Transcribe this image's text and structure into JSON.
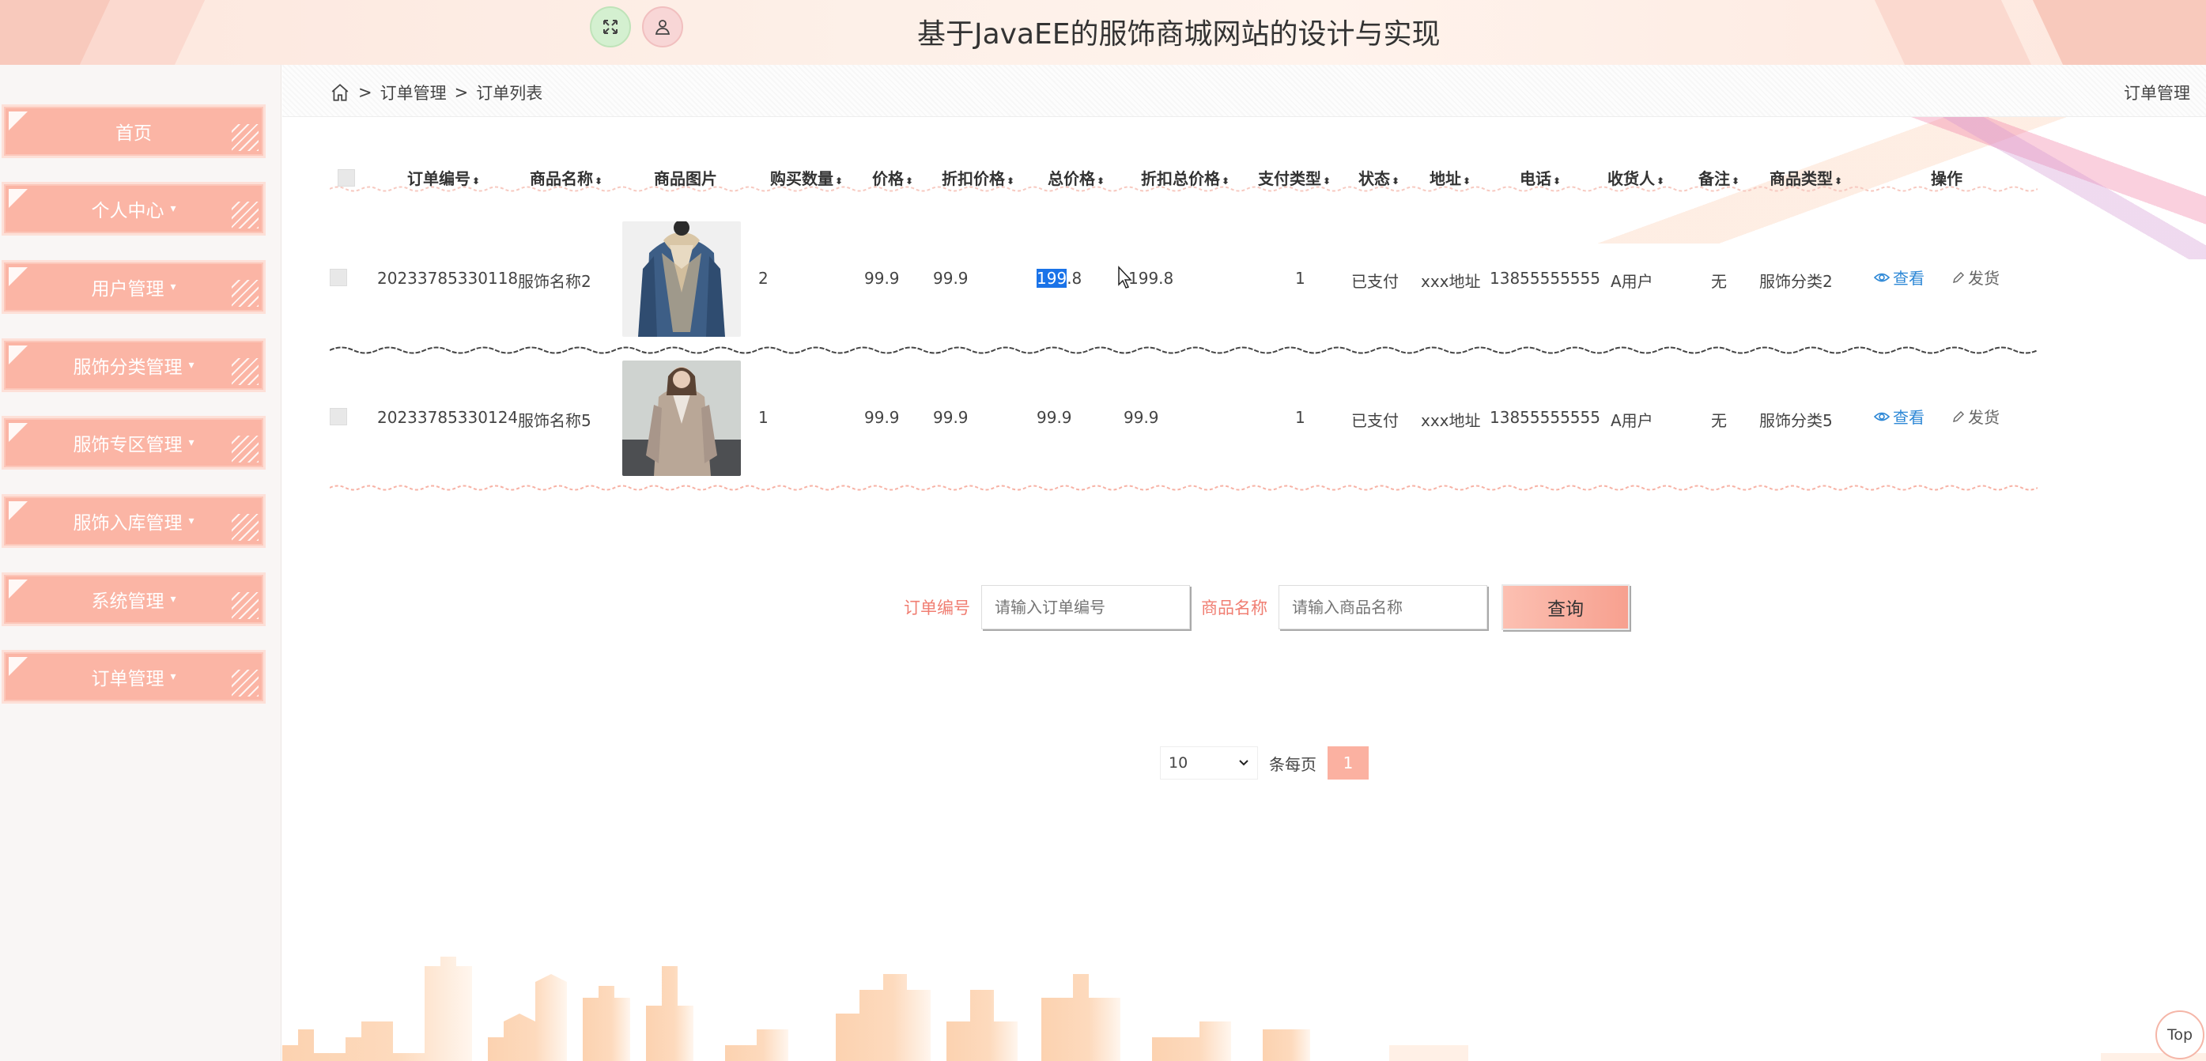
{
  "header": {
    "title": "基于JavaEE的服饰商城网站的设计与实现"
  },
  "sidebar": {
    "items": [
      {
        "label": "首页",
        "caret": ""
      },
      {
        "label": "个人中心",
        "caret": "▾"
      },
      {
        "label": "用户管理",
        "caret": "▾"
      },
      {
        "label": "服饰分类管理",
        "caret": "▾"
      },
      {
        "label": "服饰专区管理",
        "caret": "▾"
      },
      {
        "label": "服饰入库管理",
        "caret": "▾"
      },
      {
        "label": "系统管理",
        "caret": "▾"
      },
      {
        "label": "订单管理",
        "caret": "▾"
      }
    ]
  },
  "breadcrumb": {
    "sep1": ">",
    "level1": "订单管理",
    "sep2": ">",
    "level2": "订单列表",
    "right": "订单管理"
  },
  "table": {
    "columns": [
      "订单编号",
      "商品名称",
      "商品图片",
      "购买数量",
      "价格",
      "折扣价格",
      "总价格",
      "折扣总价格",
      "支付类型",
      "状态",
      "地址",
      "电话",
      "收货人",
      "备注",
      "商品类型",
      "操作"
    ],
    "sort_icon": "⬍",
    "rows": [
      {
        "order_no": "20233785330118",
        "product_name": "服饰名称2",
        "image": "denim-jacket",
        "quantity": "2",
        "price": "99.9",
        "discount_price": "99.9",
        "total_selected": "199",
        "total_rest": ".8",
        "discount_total": "199.8",
        "pay_type": "1",
        "status": "已支付",
        "address": "xxx地址",
        "phone": "13855555555",
        "receiver": "A用户",
        "remark": "无",
        "category": "服饰分类2",
        "view_label": "查看",
        "ship_label": "发货"
      },
      {
        "order_no": "20233785330124",
        "product_name": "服饰名称5",
        "image": "beige-coat",
        "quantity": "1",
        "price": "99.9",
        "discount_price": "99.9",
        "total_selected": "",
        "total_rest": "99.9",
        "discount_total": "99.9",
        "pay_type": "1",
        "status": "已支付",
        "address": "xxx地址",
        "phone": "13855555555",
        "receiver": "A用户",
        "remark": "无",
        "category": "服饰分类5",
        "view_label": "查看",
        "ship_label": "发货"
      }
    ]
  },
  "search": {
    "order_label": "订单编号",
    "order_placeholder": "请输入订单编号",
    "name_label": "商品名称",
    "name_placeholder": "请输入商品名称",
    "button": "查询"
  },
  "pagination": {
    "page_size": "10",
    "per_page_label": "条每页",
    "current_page": "1"
  },
  "top_button": "Top",
  "colors": {
    "accent": "#fbb5a5",
    "link": "#2e88d6",
    "label": "#f07e72",
    "skyline": "#fcd2b0"
  },
  "icons": {
    "expand": "expand-icon",
    "user": "user-icon",
    "home": "home-icon",
    "view": "eye-icon",
    "ship": "edit-icon"
  }
}
